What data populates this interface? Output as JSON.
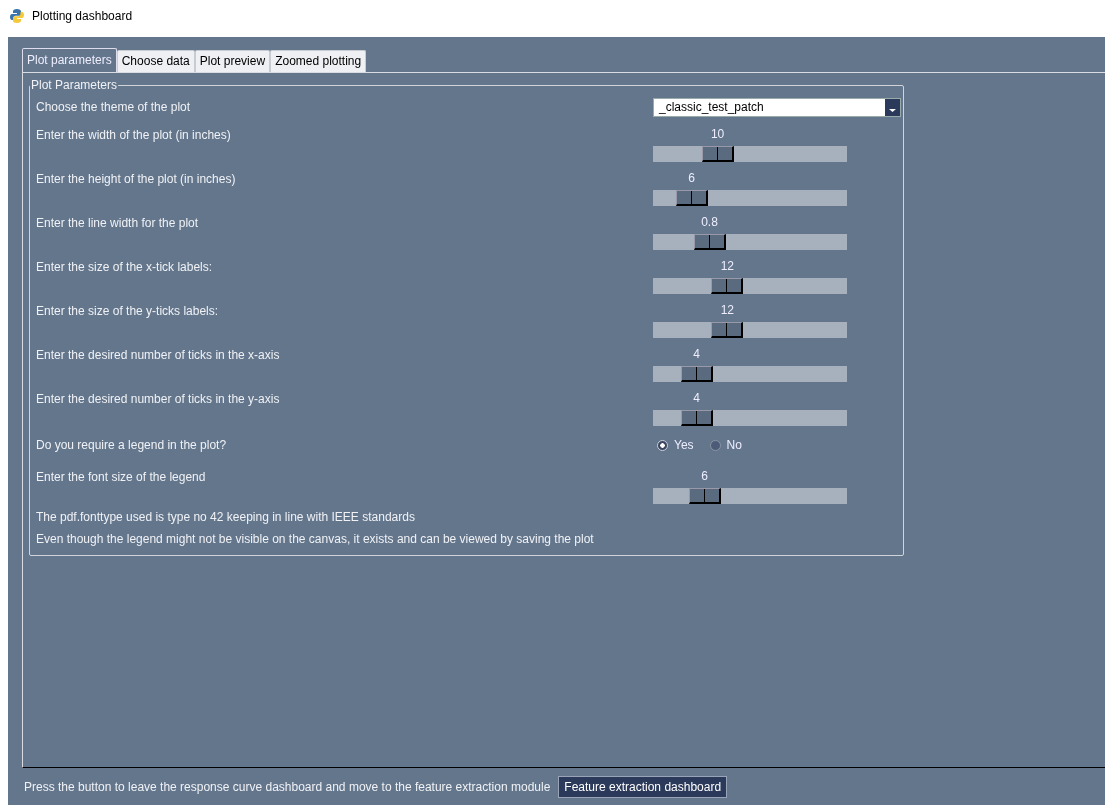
{
  "window": {
    "title": "Plotting dashboard"
  },
  "tabs": [
    {
      "label": "Plot parameters",
      "selected": true
    },
    {
      "label": "Choose data",
      "selected": false
    },
    {
      "label": "Plot preview",
      "selected": false
    },
    {
      "label": "Zoomed plotting",
      "selected": false
    }
  ],
  "panel": {
    "title": "Plot Parameters",
    "rows": [
      {
        "kind": "dropdown",
        "label": "Choose the theme of the plot",
        "value": "_classic_test_patch"
      },
      {
        "kind": "slider",
        "label": "Enter the width of the plot (in inches)",
        "reading": "10",
        "level": 0.3
      },
      {
        "kind": "slider",
        "label": "Enter the height of the plot (in inches)",
        "reading": "6",
        "level": 0.14
      },
      {
        "kind": "slider",
        "label": "Enter the line width for the plot",
        "reading": "0.8",
        "level": 0.25
      },
      {
        "kind": "slider",
        "label": "Enter the size of the x-tick labels:",
        "reading": "12",
        "level": 0.36
      },
      {
        "kind": "slider",
        "label": "Enter the size of the y-ticks labels:",
        "reading": "12",
        "level": 0.36
      },
      {
        "kind": "slider",
        "label": "Enter the desired number of ticks in the x-axis",
        "reading": "4",
        "level": 0.17
      },
      {
        "kind": "slider",
        "label": "Enter the desired number of ticks in the y-axis",
        "reading": "4",
        "level": 0.17
      },
      {
        "kind": "radio",
        "label": "Do you require a legend in the plot?",
        "options": [
          {
            "label": "Yes",
            "selected": true
          },
          {
            "label": "No",
            "selected": false
          }
        ]
      },
      {
        "kind": "slider",
        "label": "Enter the font size of the legend",
        "reading": "6",
        "level": 0.22
      },
      {
        "kind": "text",
        "label": "The pdf.fonttype used is type no 42 keeping in line with IEEE standards"
      },
      {
        "kind": "text",
        "label": "Even though the legend might not be visible on the canvas, it exists and can be viewed by saving the plot"
      }
    ]
  },
  "footer": {
    "text": "Press the button to leave the response curve dashboard and move to the feature extraction module",
    "button": "Feature extraction dashboard"
  }
}
